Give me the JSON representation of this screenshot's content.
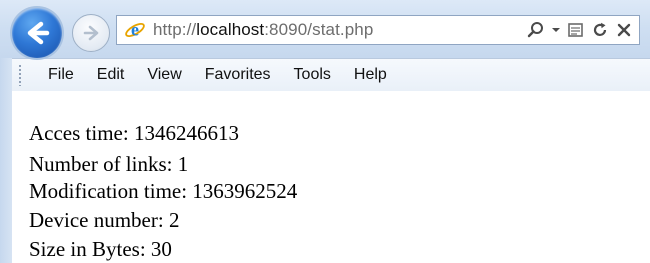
{
  "browser": {
    "url_prefix": "http://",
    "url_host": "localhost",
    "url_rest": ":8090/stat.php"
  },
  "menu": [
    "File",
    "Edit",
    "View",
    "Favorites",
    "Tools",
    "Help"
  ],
  "stats": [
    "Acces time: 1346246613",
    "Number of links: 1",
    "Modification time: 1363962524",
    "Device number: 2",
    "Size in Bytes: 30"
  ],
  "colors": {
    "chrome": "#cfdff2",
    "back_button": "#2f78d6",
    "ie_logo": "#1e7fd8"
  },
  "icons": {
    "back": "back-arrow-icon",
    "forward": "forward-arrow-icon",
    "page": "internet-explorer-icon",
    "search": "search-icon",
    "dropdown": "dropdown-caret-icon",
    "compat": "compatibility-view-icon",
    "refresh": "refresh-icon",
    "stop": "stop-icon"
  }
}
